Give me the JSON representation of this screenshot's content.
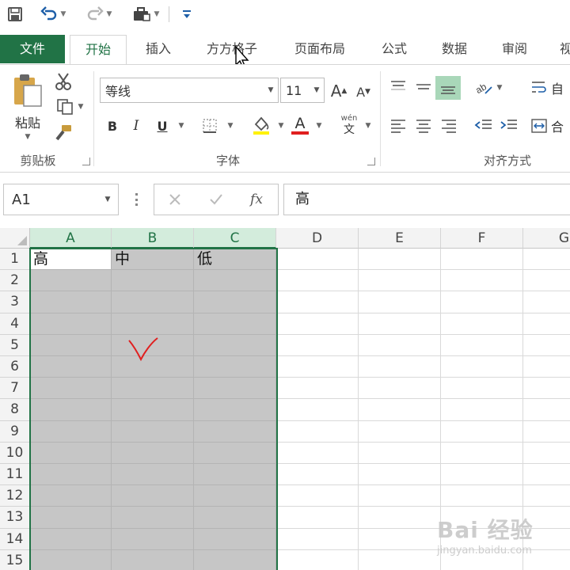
{
  "colors": {
    "accent": "#217346",
    "selection": "#c6c6c6",
    "annotation": "#e02020"
  },
  "ribbon_tabs": [
    "文件",
    "开始",
    "插入",
    "方方格子",
    "页面布局",
    "公式",
    "数据",
    "审阅",
    "视"
  ],
  "clipboard": {
    "paste_label": "粘贴",
    "group_label": "剪贴板"
  },
  "font": {
    "name": "等线",
    "size": "11",
    "bold": "B",
    "italic": "I",
    "underline": "U",
    "phonetic_top": "wén",
    "phonetic_bottom": "文",
    "group_label": "字体"
  },
  "alignment": {
    "group_label": "对齐方式",
    "wrap_label": "自",
    "merge_label": "合"
  },
  "formula_bar": {
    "name_box": "A1",
    "content": "高",
    "fx": "fx"
  },
  "sheet": {
    "columns": [
      "A",
      "B",
      "C",
      "D",
      "E",
      "F",
      "G"
    ],
    "rows": [
      "1",
      "2",
      "3",
      "4",
      "5",
      "6",
      "7",
      "8",
      "9",
      "10",
      "11",
      "12",
      "13",
      "14",
      "15"
    ],
    "row1": [
      "高",
      "中",
      "低"
    ],
    "selected_range": "A1:C15"
  },
  "watermark": {
    "brand": "Bai 经验",
    "url": "jingyan.baidu.com"
  }
}
